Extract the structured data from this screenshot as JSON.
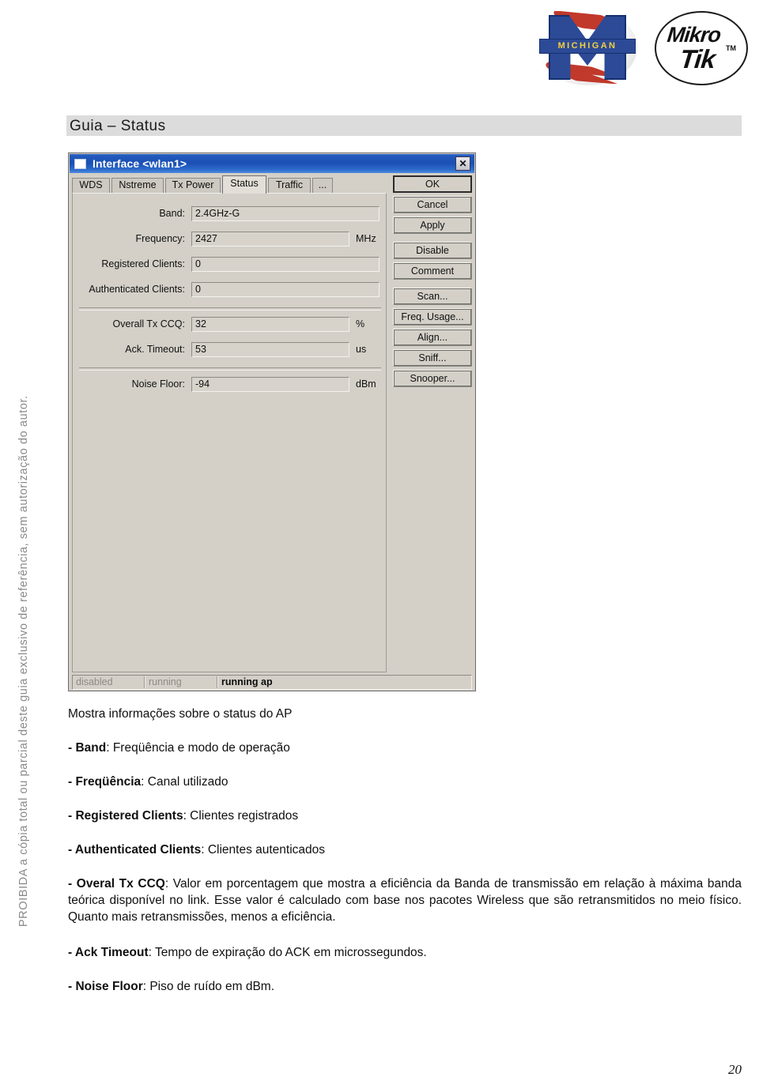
{
  "header": {
    "logo_michigan": {
      "wordmark": "MICHIGAN",
      "letter": "M",
      "alt": "michigan-logo"
    },
    "logo_mikrotik": {
      "line1": "Mikro",
      "line2": "Tik",
      "trademark": "TM"
    }
  },
  "sidebar": {
    "notice": "PROIBIDA a cópia total ou parcial deste guia exclusivo de referência, sem autorização do autor."
  },
  "section": {
    "title": "Guia – Status"
  },
  "dialog": {
    "title": "Interface <wlan1>",
    "close_label": "✕",
    "tabs": [
      {
        "label": "WDS",
        "active": false
      },
      {
        "label": "Nstreme",
        "active": false
      },
      {
        "label": "Tx Power",
        "active": false
      },
      {
        "label": "Status",
        "active": true
      },
      {
        "label": "Traffic",
        "active": false
      },
      {
        "label": "...",
        "active": false
      }
    ],
    "fields": [
      {
        "label": "Band:",
        "value": "2.4GHz-G",
        "unit": ""
      },
      {
        "label": "Frequency:",
        "value": "2427",
        "unit": "MHz"
      },
      {
        "label": "Registered Clients:",
        "value": "0",
        "unit": ""
      },
      {
        "label": "Authenticated Clients:",
        "value": "0",
        "unit": ""
      },
      {
        "label": "Overall Tx CCQ:",
        "value": "32",
        "unit": "%"
      },
      {
        "label": "Ack. Timeout:",
        "value": "53",
        "unit": "us"
      },
      {
        "label": "Noise Floor:",
        "value": "-94",
        "unit": "dBm"
      }
    ],
    "buttons": [
      {
        "label": "OK",
        "default": true
      },
      {
        "label": "Cancel",
        "default": false
      },
      {
        "label": "Apply",
        "default": false
      },
      {
        "label": "Disable",
        "default": false
      },
      {
        "label": "Comment",
        "default": false
      },
      {
        "label": "Scan...",
        "default": false
      },
      {
        "label": "Freq. Usage...",
        "default": false
      },
      {
        "label": "Align...",
        "default": false
      },
      {
        "label": "Sniff...",
        "default": false
      },
      {
        "label": "Snooper...",
        "default": false
      }
    ],
    "statusbar": [
      {
        "label": "disabled",
        "state": "dim"
      },
      {
        "label": "running",
        "state": "dim"
      },
      {
        "label": "running ap",
        "state": "on"
      }
    ]
  },
  "body": {
    "intro": "Mostra informações sobre o status do AP",
    "items": [
      {
        "term": "- Band",
        "desc": ": Freqüência e modo de operação"
      },
      {
        "term": "- Freqüência",
        "desc": ": Canal utilizado"
      },
      {
        "term": "- Registered Clients",
        "desc": ": Clientes registrados"
      },
      {
        "term": "- Authenticated Clients",
        "desc": ": Clientes autenticados"
      }
    ],
    "ccq_term": "- Overal Tx CCQ",
    "ccq_desc": ": Valor em porcentagem que mostra a eficiência da Banda de transmissão em relação à máxima banda teórica disponível no link. Esse valor é calculado com base nos pacotes Wireless que são retransmitidos no meio físico. Quanto mais retransmissões, menos a eficiência.",
    "ack_term": "- Ack Timeout",
    "ack_desc": ": Tempo de expiração do ACK em microssegundos.",
    "noise_term": "- Noise Floor",
    "noise_desc": ": Piso de ruído em dBm."
  },
  "footer": {
    "page_number": "20"
  }
}
